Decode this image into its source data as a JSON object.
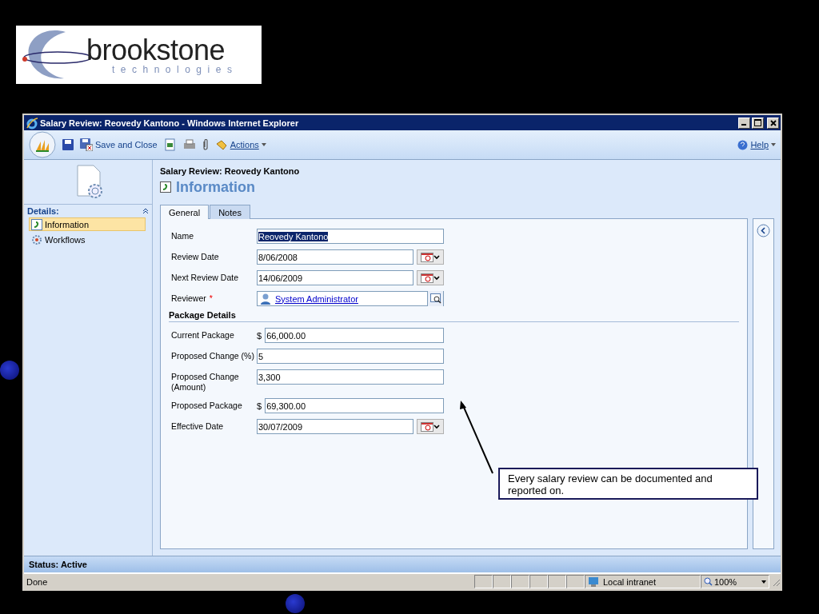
{
  "slide": {
    "logo": {
      "name": "brookstone",
      "tagline": "technologies"
    },
    "callout": "Every salary review can be documented and reported on."
  },
  "window": {
    "title": "Salary Review: Reovedy Kantono - Windows Internet Explorer"
  },
  "toolbar": {
    "save_and_close": "Save and Close",
    "actions": "Actions",
    "help": "Help"
  },
  "sidebar": {
    "header": "Details:",
    "items": [
      {
        "label": "Information",
        "selected": true
      },
      {
        "label": "Workflows",
        "selected": false
      }
    ]
  },
  "form": {
    "record_title": "Salary Review: Reovedy Kantono",
    "heading": "Information",
    "tabs": [
      {
        "label": "General",
        "selected": true
      },
      {
        "label": "Notes",
        "selected": false
      }
    ],
    "fields": [
      {
        "kind": "text",
        "label": "Name",
        "value": "Reovedy Kantono",
        "highlighted": true
      },
      {
        "kind": "date",
        "label": "Review Date",
        "value": "8/06/2008"
      },
      {
        "kind": "date",
        "label": "Next Review Date",
        "value": "14/06/2009"
      },
      {
        "kind": "lookup",
        "label": "Reviewer",
        "required_mark": "*",
        "value": "System Administrator"
      }
    ],
    "section": "Package Details",
    "package_fields": [
      {
        "kind": "currency",
        "label": "Current Package",
        "prefix": "$",
        "value": "66,000.00"
      },
      {
        "kind": "text",
        "label": "Proposed Change (%)",
        "value": "5",
        "highlighted": false
      },
      {
        "kind": "text",
        "label": "Proposed Change (Amount)",
        "value": "3,300",
        "highlighted": false
      },
      {
        "kind": "currency",
        "label": "Proposed Package",
        "prefix": "$",
        "value": "69,300.00"
      },
      {
        "kind": "date",
        "label": "Effective Date",
        "value": "30/07/2009"
      }
    ]
  },
  "status": "Status: Active",
  "browser_status": {
    "text": "Done",
    "zone": "Local intranet",
    "zoom": "100%"
  }
}
